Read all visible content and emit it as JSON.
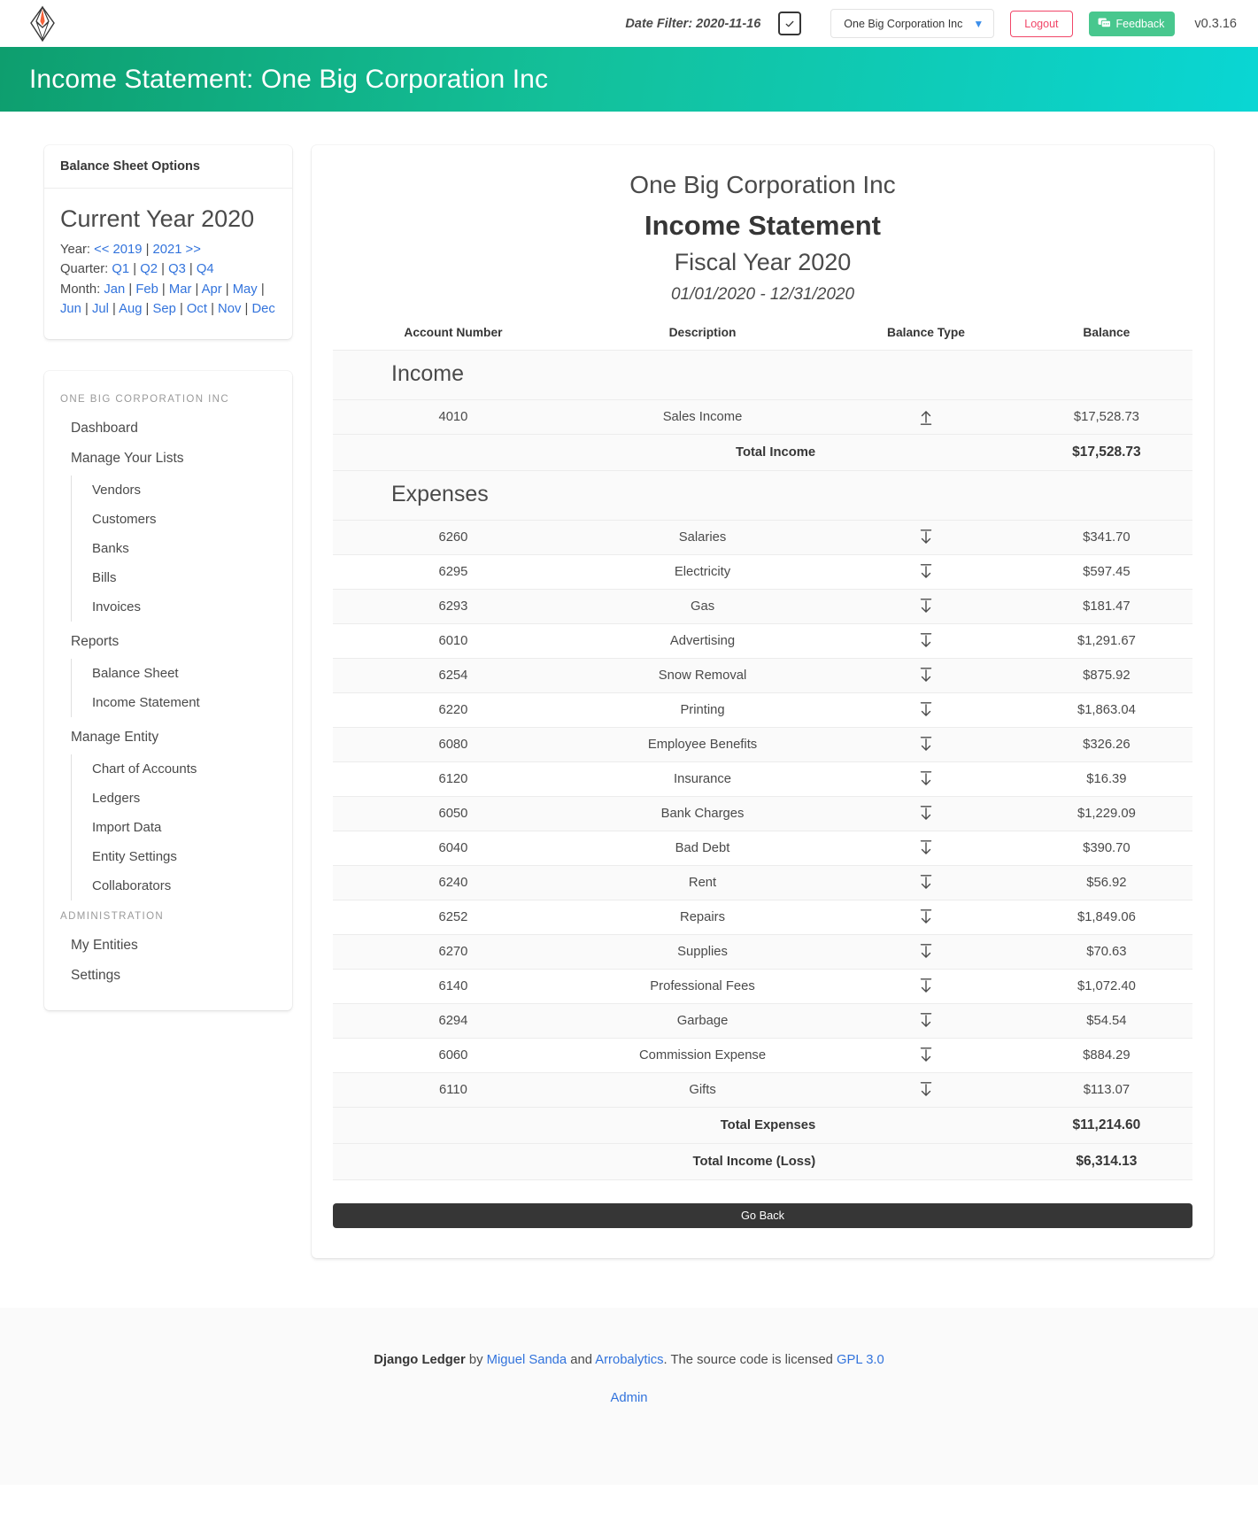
{
  "topnav": {
    "logo_icon": "arrobalytics-diamond-logo",
    "date_filter_label": "Date Filter: 2020-11-16",
    "calendar_icon": "calendar-check-icon",
    "entity_select_value": "One Big Corporation Inc",
    "chevron_icon": "chevron-down-icon",
    "logout_label": "Logout",
    "feedback_label": "Feedback",
    "feedback_icon": "comment-dots-icon",
    "version_label": "v0.3.16"
  },
  "hero": {
    "title": "Income Statement: One Big Corporation Inc"
  },
  "options": {
    "header": "Balance Sheet Options",
    "current_year": "Current Year 2020",
    "year_label": "Year:",
    "year_links": [
      "<< 2019",
      "2021 >>"
    ],
    "quarter_label": "Quarter:",
    "quarter_links": [
      "Q1",
      "Q2",
      "Q3",
      "Q4"
    ],
    "month_label": "Month:",
    "month_links": [
      "Jan",
      "Feb",
      "Mar",
      "Apr",
      "May",
      "Jun",
      "Jul",
      "Aug",
      "Sep",
      "Oct",
      "Nov",
      "Dec"
    ]
  },
  "sidebar": {
    "entity_label": "ONE BIG CORPORATION INC",
    "dashboard": "Dashboard",
    "manage_lists": "Manage Your Lists",
    "lists_items": [
      "Vendors",
      "Customers",
      "Banks",
      "Bills",
      "Invoices"
    ],
    "reports": "Reports",
    "reports_items": [
      "Balance Sheet",
      "Income Statement"
    ],
    "manage_entity": "Manage Entity",
    "entity_items": [
      "Chart of Accounts",
      "Ledgers",
      "Import Data",
      "Entity Settings",
      "Collaborators"
    ],
    "administration_label": "ADMINISTRATION",
    "admin_items": [
      "My Entities",
      "Settings"
    ]
  },
  "report": {
    "company": "One Big Corporation Inc",
    "title": "Income Statement",
    "fiscal_year": "Fiscal Year 2020",
    "date_range": "01/01/2020 - 12/31/2020",
    "columns": [
      "Account Number",
      "Description",
      "Balance Type",
      "Balance"
    ],
    "income_section": "Income",
    "income_rows": [
      {
        "account": "4010",
        "description": "Sales Income",
        "balance_type": "credit",
        "balance": "$17,528.73"
      }
    ],
    "total_income_label": "Total Income",
    "total_income_value": "$17,528.73",
    "expenses_section": "Expenses",
    "expense_rows": [
      {
        "account": "6260",
        "description": "Salaries",
        "balance_type": "debit",
        "balance": "$341.70"
      },
      {
        "account": "6295",
        "description": "Electricity",
        "balance_type": "debit",
        "balance": "$597.45"
      },
      {
        "account": "6293",
        "description": "Gas",
        "balance_type": "debit",
        "balance": "$181.47"
      },
      {
        "account": "6010",
        "description": "Advertising",
        "balance_type": "debit",
        "balance": "$1,291.67"
      },
      {
        "account": "6254",
        "description": "Snow Removal",
        "balance_type": "debit",
        "balance": "$875.92"
      },
      {
        "account": "6220",
        "description": "Printing",
        "balance_type": "debit",
        "balance": "$1,863.04"
      },
      {
        "account": "6080",
        "description": "Employee Benefits",
        "balance_type": "debit",
        "balance": "$326.26"
      },
      {
        "account": "6120",
        "description": "Insurance",
        "balance_type": "debit",
        "balance": "$16.39"
      },
      {
        "account": "6050",
        "description": "Bank Charges",
        "balance_type": "debit",
        "balance": "$1,229.09"
      },
      {
        "account": "6040",
        "description": "Bad Debt",
        "balance_type": "debit",
        "balance": "$390.70"
      },
      {
        "account": "6240",
        "description": "Rent",
        "balance_type": "debit",
        "balance": "$56.92"
      },
      {
        "account": "6252",
        "description": "Repairs",
        "balance_type": "debit",
        "balance": "$1,849.06"
      },
      {
        "account": "6270",
        "description": "Supplies",
        "balance_type": "debit",
        "balance": "$70.63"
      },
      {
        "account": "6140",
        "description": "Professional Fees",
        "balance_type": "debit",
        "balance": "$1,072.40"
      },
      {
        "account": "6294",
        "description": "Garbage",
        "balance_type": "debit",
        "balance": "$54.54"
      },
      {
        "account": "6060",
        "description": "Commission Expense",
        "balance_type": "debit",
        "balance": "$884.29"
      },
      {
        "account": "6110",
        "description": "Gifts",
        "balance_type": "debit",
        "balance": "$113.07"
      }
    ],
    "total_expenses_label": "Total Expenses",
    "total_expenses_value": "$11,214.60",
    "net_income_label": "Total Income (Loss)",
    "net_income_value": "$6,314.13",
    "go_back_label": "Go Back"
  },
  "footer": {
    "brand": "Django Ledger",
    "by": " by ",
    "author": "Miguel Sanda",
    "and": " and ",
    "org": "Arrobalytics",
    "license_text": ". The source code is licensed ",
    "license": "GPL 3.0",
    "admin": "Admin"
  },
  "colors": {
    "hero_start": "#0e9e6e",
    "hero_end": "#0ad6d4",
    "link": "#3273dc",
    "danger": "#f14668",
    "success": "#48c78e",
    "dark": "#363636"
  }
}
